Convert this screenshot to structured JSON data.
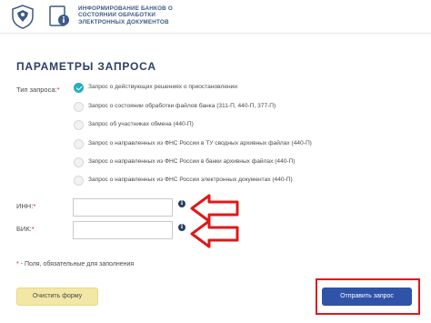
{
  "header": {
    "logo_lines": [
      "ИНФОРМИРОВАНИЕ БАНКОВ О",
      "СОСТОЯНИИ ОБРАБОТКИ",
      "ЭЛЕКТРОННЫХ ДОКУМЕНТОВ"
    ],
    "emblem_icon": "fns-eagle-emblem-icon",
    "doc_icon": "document-info-icon"
  },
  "form": {
    "title": "ПАРАМЕТРЫ ЗАПРОСА",
    "request_type_label": "Тип запроса:",
    "required_mark": "*",
    "options": [
      {
        "label": "Запрос о действующих решениях о приостановлении",
        "checked": true
      },
      {
        "label": "Запрос о состоянии обработки файлов банка (311-П, 440-П, 377-П)",
        "checked": false
      },
      {
        "label": "Запрос об участниках обмена (440-П)",
        "checked": false
      },
      {
        "label": "Запрос о направленных из ФНС России в ТУ сводных архивных файлах (440-П)",
        "checked": false
      },
      {
        "label": "Запрос о направленных из ФНС России в банки архивных файлах (440-П)",
        "checked": false
      },
      {
        "label": "Запрос о направленных из ФНС России электронных документах (440-П)",
        "checked": false
      }
    ],
    "inn_label": "ИНН:",
    "inn_value": "",
    "bik_label": "БИК:",
    "bik_value": "",
    "info_glyph": "i",
    "required_note_mark": "*",
    "required_note": " - Поля, обязательные для заполнения",
    "clear_button": "Очистить форму",
    "submit_button": "Отправить запрос"
  },
  "colors": {
    "accent": "#22aebd",
    "title": "#2c3f63",
    "submit": "#2f53a8",
    "clear": "#f3e7a6",
    "annotation_red": "#e01818"
  }
}
